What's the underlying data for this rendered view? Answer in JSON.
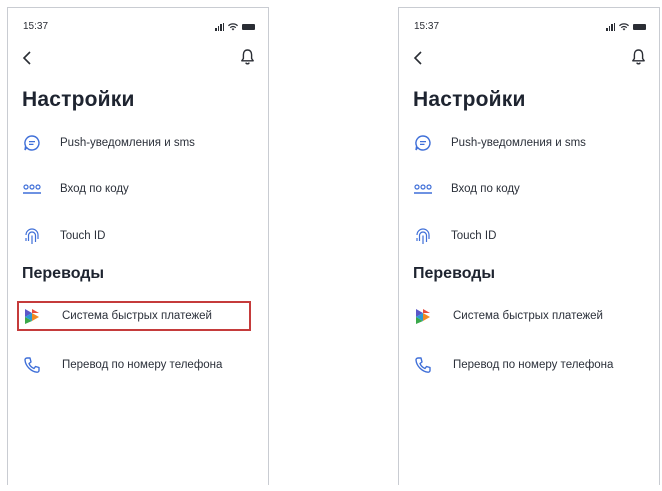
{
  "status": {
    "time": "15:37"
  },
  "screen": {
    "title": "Настройки",
    "settings_items": [
      {
        "label": "Push-уведомления и sms",
        "icon": "chat-bubble-icon"
      },
      {
        "label": "Вход по коду",
        "icon": "pin-code-icon"
      },
      {
        "label": "Touch ID",
        "icon": "fingerprint-icon"
      }
    ],
    "transfers_section": "Переводы",
    "transfer_items": [
      {
        "label": "Система быстрых платежей",
        "icon": "sbp-logo-icon"
      },
      {
        "label": "Перевод по номеру телефона",
        "icon": "phone-icon"
      }
    ]
  },
  "colors": {
    "accent": "#3f6fd8",
    "highlight": "#c53b3b",
    "text": "#1e2430"
  }
}
